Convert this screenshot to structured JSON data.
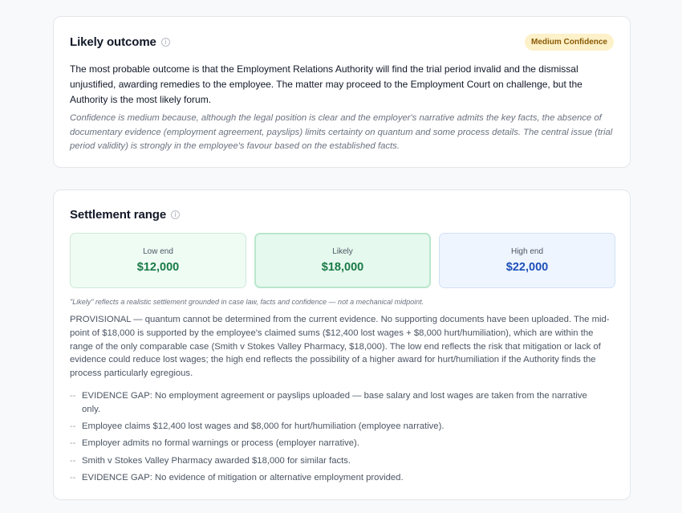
{
  "outcome": {
    "title": "Likely outcome",
    "badge": "Medium Confidence",
    "text": "The most probable outcome is that the Employment Relations Authority will find the trial period invalid and the dismissal unjustified, awarding remedies to the employee. The matter may proceed to the Employment Court on challenge, but the Authority is the most likely forum.",
    "note": "Confidence is medium because, although the legal position is clear and the employer's narrative admits the key facts, the absence of documentary evidence (employment agreement, payslips) limits certainty on quantum and some process details. The central issue (trial period validity) is strongly in the employee's favour based on the established facts."
  },
  "settlement": {
    "title": "Settlement range",
    "low": {
      "label": "Low end",
      "value": "$12,000"
    },
    "likely": {
      "label": "Likely",
      "value": "$18,000"
    },
    "high": {
      "label": "High end",
      "value": "$22,000"
    },
    "range_note": "\"Likely\" reflects a realistic settlement grounded in case law, facts and confidence — not a mechanical midpoint.",
    "provisional": "PROVISIONAL — quantum cannot be determined from the current evidence. No supporting documents have been uploaded. The mid-point of $18,000 is supported by the employee's claimed sums ($12,400 lost wages + $8,000 hurt/humiliation), which are within the range of the only comparable case (Smith v Stokes Valley Pharmacy, $18,000). The low end reflects the risk that mitigation or lack of evidence could reduce lost wages; the high end reflects the possibility of a higher award for hurt/humiliation if the Authority finds the process particularly egregious.",
    "bullet_marker": "--",
    "facts": [
      "EVIDENCE GAP: No employment agreement or payslips uploaded — base salary and lost wages are taken from the narrative only.",
      "Employee claims $12,400 lost wages and $8,000 for hurt/humiliation (employee narrative).",
      "Employer admits no formal warnings or process (employer narrative).",
      "Smith v Stokes Valley Pharmacy awarded $18,000 for similar facts.",
      "EVIDENCE GAP: No evidence of mitigation or alternative employment provided."
    ]
  },
  "icons": {
    "info": "info-icon"
  },
  "colors": {
    "badge_bg": "#fdf1c9",
    "badge_text": "#8a5a06",
    "green": "#1a7a46",
    "blue": "#1d4fb8"
  }
}
